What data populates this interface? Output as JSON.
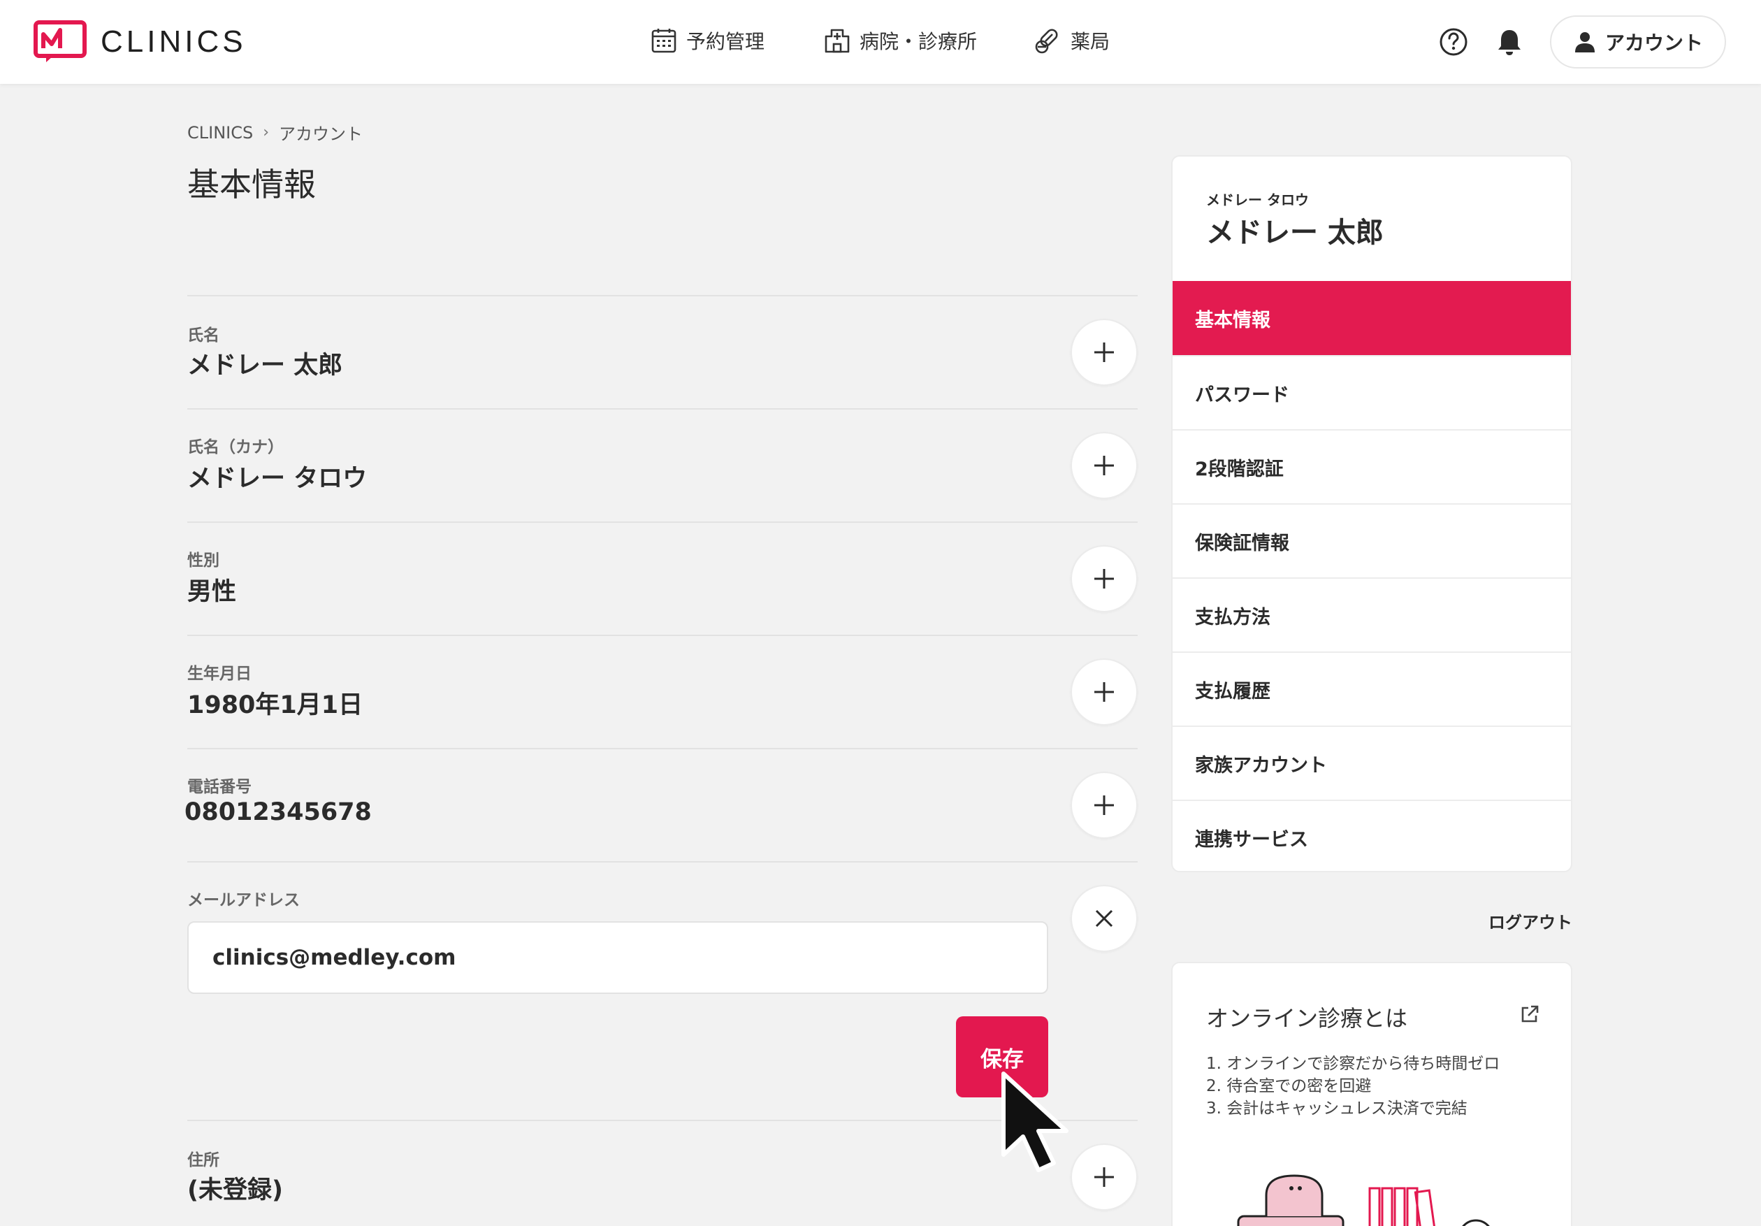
{
  "header": {
    "logo_text": "CLINICS",
    "nav": [
      {
        "label": "予約管理",
        "icon": "calendar-icon"
      },
      {
        "label": "病院・診療所",
        "icon": "hospital-icon"
      },
      {
        "label": "薬局",
        "icon": "pills-icon"
      }
    ],
    "account_label": "アカウント"
  },
  "breadcrumb": [
    "CLINICS",
    "アカウント"
  ],
  "page_title": "基本情報",
  "fields": [
    {
      "label": "氏名",
      "value": "メドレー 太郎"
    },
    {
      "label": "氏名（カナ）",
      "value": "メドレー タロウ"
    },
    {
      "label": "性別",
      "value": "男性"
    },
    {
      "label": "生年月日",
      "value": "1980年1月1日"
    },
    {
      "label": "電話番号",
      "value": "08012345678"
    }
  ],
  "email": {
    "label": "メールアドレス",
    "value": "clinics@medley.com"
  },
  "save_label": "保存",
  "address": {
    "label": "住所",
    "value": "(未登録)"
  },
  "profile": {
    "kana": "メドレー タロウ",
    "name": "メドレー 太郎"
  },
  "menu": [
    "基本情報",
    "パスワード",
    "2段階認証",
    "保険証情報",
    "支払方法",
    "支払履歴",
    "家族アカウント",
    "連携サービス"
  ],
  "logout_label": "ログアウト",
  "info_card": {
    "title": "オンライン診療とは",
    "items": [
      "1. オンラインで診察だから待ち時間ゼロ",
      "2. 待合室での密を回避",
      "3. 会計はキャッシュレス決済で完結"
    ]
  },
  "colors": {
    "accent": "#e31b50",
    "background": "#f2f2f2"
  }
}
